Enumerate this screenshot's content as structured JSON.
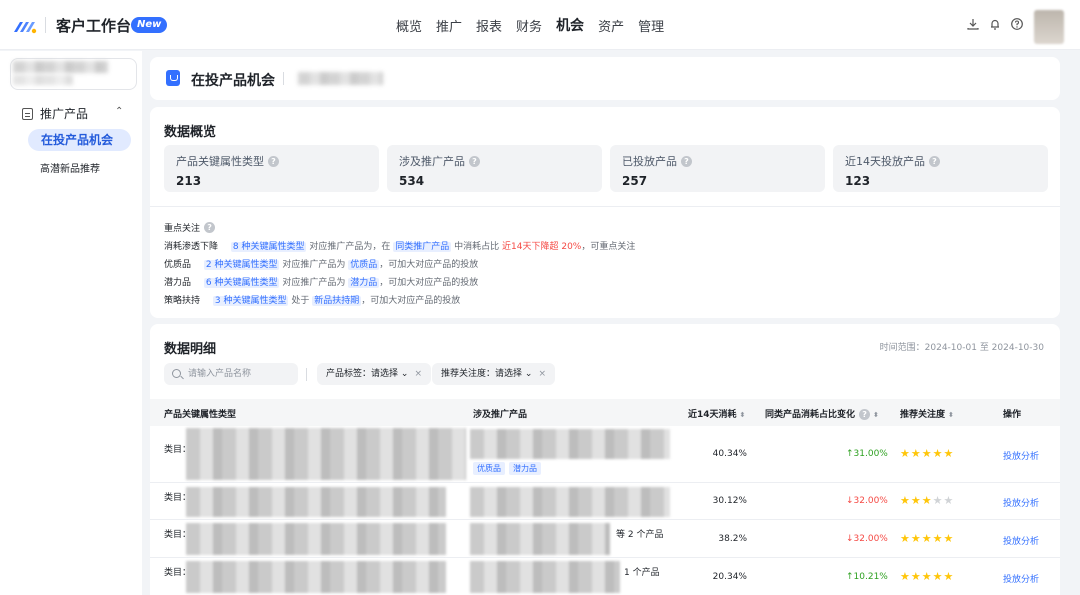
{
  "topbar": {
    "app_title": "客户工作台",
    "new_badge": "New",
    "nav": [
      "概览",
      "推广",
      "报表",
      "财务",
      "机会",
      "资产",
      "管理"
    ],
    "active_nav": "机会",
    "icons": [
      "download-icon",
      "bell-icon",
      "help-icon"
    ]
  },
  "sidebar": {
    "group_label": "推广产品",
    "items": [
      "在投产品机会",
      "高潜新品推荐"
    ],
    "active_item": "在投产品机会"
  },
  "header": {
    "title": "在投产品机会"
  },
  "overview": {
    "title": "数据概览",
    "stats": [
      {
        "label": "产品关键属性类型",
        "value": "213"
      },
      {
        "label": "涉及推广产品",
        "value": "534"
      },
      {
        "label": "已投放产品",
        "value": "257"
      },
      {
        "label": "近14天投放产品",
        "value": "123"
      }
    ],
    "focus_title": "重点关注",
    "focus": [
      {
        "key": "消耗渗透下降",
        "a": "8 种关键属性类型",
        "b": "对应推广产品为，在",
        "c": "同类推广产品",
        "d": "中消耗占比",
        "e": "近14天下降超 20%",
        "f": "，可重点关注"
      },
      {
        "key": "优质品",
        "a": "2 种关键属性类型",
        "b": "对应推广产品为",
        "c": "优质品",
        "d": "，可加大对应产品的投放"
      },
      {
        "key": "潜力品",
        "a": "6 种关键属性类型",
        "b": "对应推广产品为",
        "c": "潜力品",
        "d": "，可加大对应产品的投放"
      },
      {
        "key": "策略扶持",
        "a": "3 种关键属性类型",
        "b": "处于",
        "c": "新品扶持期",
        "d": "，可加大对应产品的投放"
      }
    ]
  },
  "detail": {
    "title": "数据明细",
    "time_range": "时间范围：2024-10-01 至 2024-10-30",
    "search_placeholder": "请输入产品名称",
    "filter_tag": "产品标签：请选择",
    "filter_focus": "推荐关注度：请选择",
    "columns": [
      "产品关键属性类型",
      "涉及推广产品",
      "近14天消耗",
      "同类产品消耗占比变化",
      "推荐关注度",
      "操作"
    ],
    "rows": [
      {
        "type_prefix": "类目：",
        "products_suffix": "",
        "tags": [
          "优质品",
          "潜力品"
        ],
        "spend": "40.34%",
        "change": "31.00%",
        "dir": "up",
        "stars": 5,
        "action": "投放分析"
      },
      {
        "type_prefix": "类目：",
        "products_suffix": "",
        "tags": [],
        "spend": "30.12%",
        "change": "32.00%",
        "dir": "down",
        "stars": 3,
        "action": "投放分析"
      },
      {
        "type_prefix": "类目：",
        "products_suffix": "等 2 个产品",
        "tags": [],
        "spend": "38.2%",
        "change": "32.00%",
        "dir": "down",
        "stars": 5,
        "action": "投放分析"
      },
      {
        "type_prefix": "类目：",
        "products_suffix": "1 个产品",
        "tags": [],
        "spend": "20.34%",
        "change": "10.21%",
        "dir": "up",
        "stars": 5,
        "action": "投放分析"
      }
    ]
  }
}
